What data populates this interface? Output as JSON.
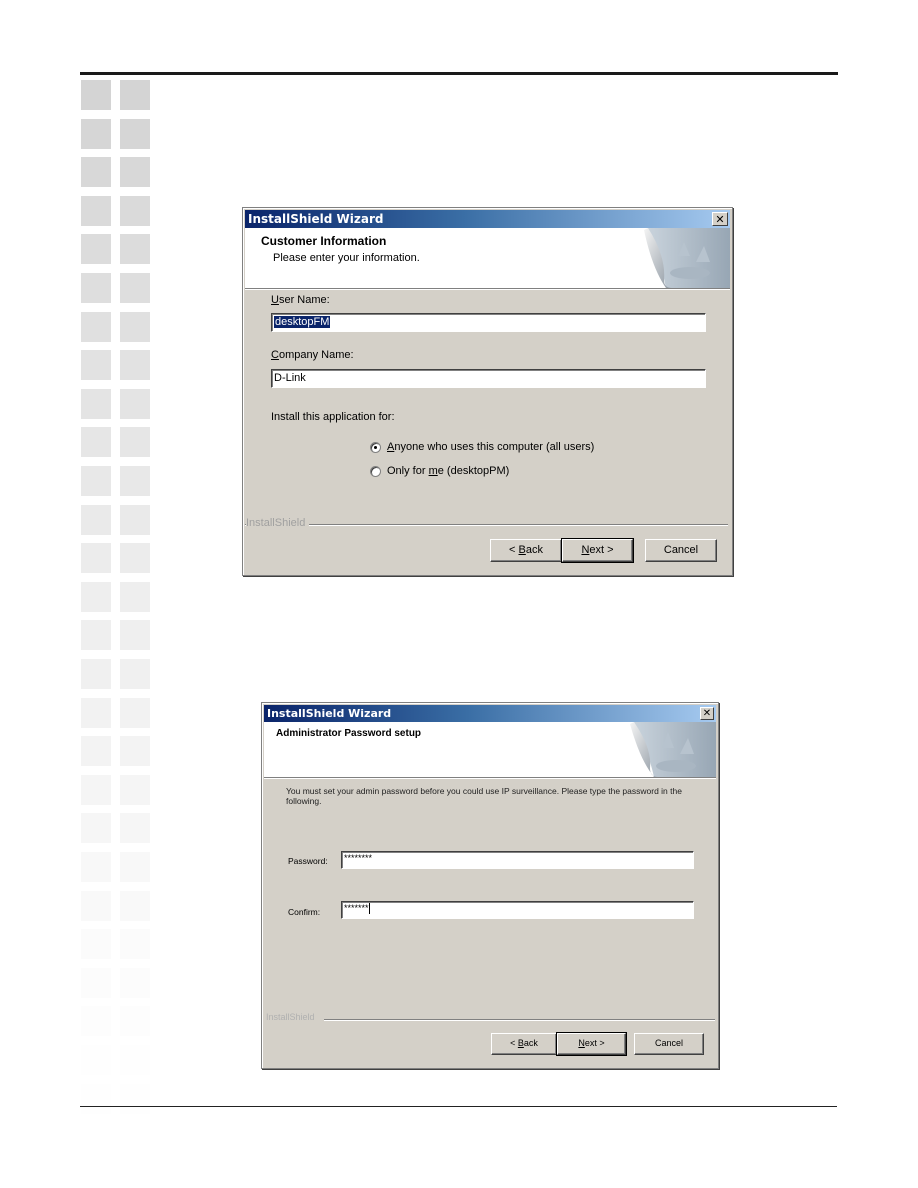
{
  "page": {
    "decor_square_shades": [
      "#d4d4d4",
      "#d6d6d6",
      "#d8d8d8",
      "#dadada",
      "#dcdcdc",
      "#dedede",
      "#e0e0e0",
      "#e2e2e2",
      "#e4e4e4",
      "#e6e6e6",
      "#e8e8e8",
      "#eaeaea",
      "#ececec",
      "#eeeeee",
      "#efefef",
      "#f0f0f0",
      "#f2f2f2",
      "#f3f3f3",
      "#f5f5f5",
      "#f6f6f6",
      "#f8f8f8",
      "#f9f9f9",
      "#fbfbfb",
      "#fcfcfc",
      "#fdfdfd",
      "#fefefe",
      "#fefefe"
    ]
  },
  "dialog1": {
    "title": "InstallShield Wizard",
    "close_glyph": "✕",
    "banner_title": "Customer Information",
    "banner_subtitle": "Please enter your information.",
    "user_name_label_accel": "U",
    "user_name_label_rest": "ser Name:",
    "user_name_value": "desktopFM",
    "company_label_accel": "C",
    "company_label_rest": "ompany Name:",
    "company_value": "D-Link",
    "install_for_label": "Install this application for:",
    "radio_options": [
      {
        "accel_pre": "",
        "accel": "A",
        "rest": "nyone who uses this computer (all users)",
        "selected": true
      },
      {
        "accel_pre": "Only for ",
        "accel": "m",
        "rest": "e (desktopPM)",
        "selected": false
      }
    ],
    "brand": "InstallShield",
    "buttons": {
      "back_pre": "< ",
      "back_accel": "B",
      "back_rest": "ack",
      "next_accel": "N",
      "next_rest": "ext >",
      "cancel": "Cancel"
    }
  },
  "dialog2": {
    "title": "InstallShield Wizard",
    "close_glyph": "✕",
    "banner_title": "Administrator Password setup",
    "instructions": "You must set your admin password before you could use IP surveillance. Please type the password in the following.",
    "password_label": "Password:",
    "password_value": "********",
    "confirm_label": "Confirm:",
    "confirm_value": "*******",
    "brand": "InstallShield",
    "buttons": {
      "back_pre": "< ",
      "back_accel": "B",
      "back_rest": "ack",
      "next_accel": "N",
      "next_rest": "ext >",
      "cancel": "Cancel"
    }
  }
}
